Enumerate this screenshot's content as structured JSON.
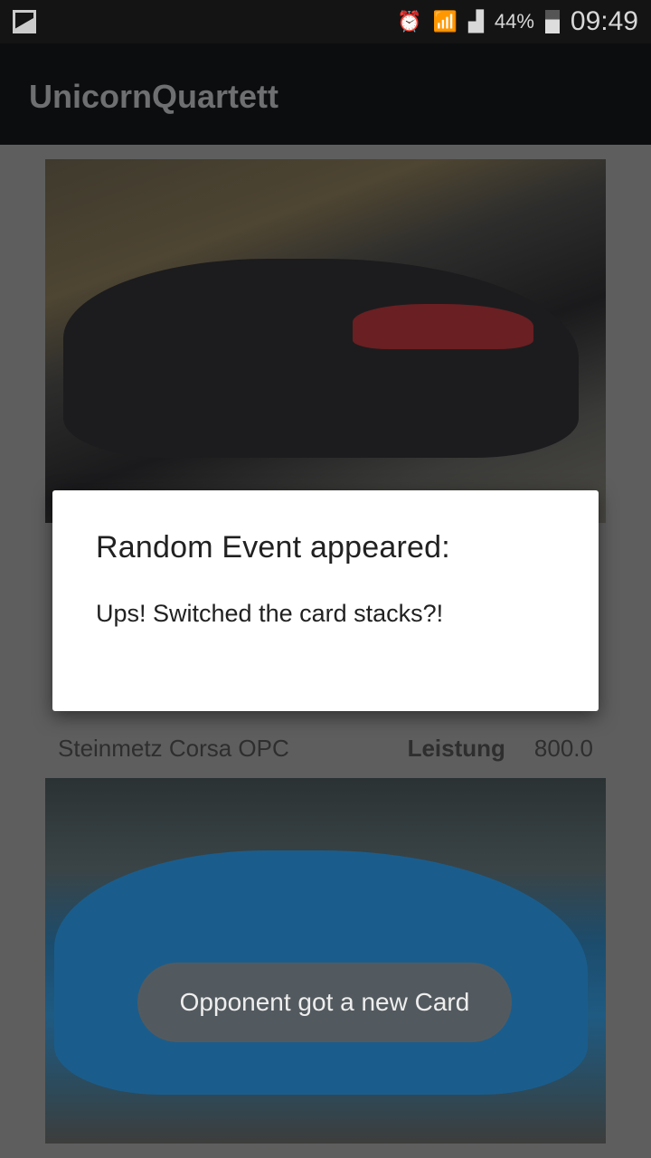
{
  "status_bar": {
    "battery": "44%",
    "time": "09:49",
    "icons": [
      "gallery-icon",
      "alarm-icon",
      "wifi-icon",
      "signal-icon",
      "battery-icon"
    ]
  },
  "app_bar": {
    "title": "UnicornQuartett"
  },
  "cards": [
    {
      "image": "grey-convertible-photo"
    },
    {
      "name": "Steinmetz Corsa OPC",
      "attribute": "Leistung",
      "value": "800.0",
      "image": "blue-corsa-photo"
    }
  ],
  "dialog": {
    "title": "Random Event appeared:",
    "message": "Ups! Switched the card stacks?!"
  },
  "toast": {
    "message": "Opponent got a new Card"
  }
}
